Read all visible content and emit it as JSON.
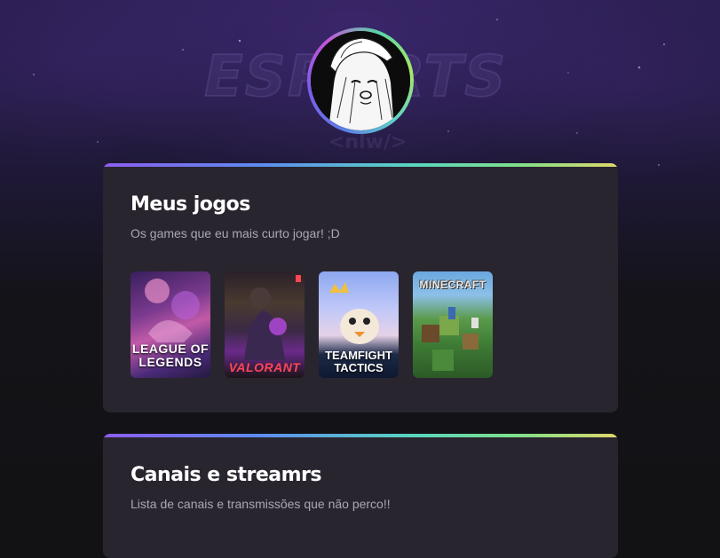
{
  "background": {
    "logo_text": "ESPORTS",
    "logo_sub": "<nlw/>"
  },
  "profile": {
    "avatar_icon": "anime-girl-avatar-icon",
    "ring_colors": [
      "#5d7be8",
      "#7b5de8",
      "#c455d8",
      "#58d6a8",
      "#a8e868"
    ]
  },
  "sections": [
    {
      "title": "Meus jogos",
      "subtitle": "Os games que eu mais curto jogar! ;D",
      "games": [
        {
          "title": "LEAGUE OF LEGENDS",
          "icon": "league-of-legends-cover-icon"
        },
        {
          "title": "VALORANT",
          "icon": "valorant-cover-icon"
        },
        {
          "title": "TEAMFIGHT TACTICS",
          "icon": "teamfight-tactics-cover-icon"
        },
        {
          "title": "MINECRAFT",
          "icon": "minecraft-cover-icon"
        }
      ]
    },
    {
      "title": "Canais e streamrs",
      "subtitle": "Lista de canais e transmissões que não perco!!"
    }
  ],
  "colors": {
    "card_bg": "#29252f",
    "page_bg": "#121214",
    "accent_gradient": [
      "#8d5df0",
      "#5d8bf0",
      "#59d5c0",
      "#7de08c",
      "#e0d86a"
    ],
    "subtitle": "#a8a8b3",
    "valorant_red": "#ff4655"
  }
}
